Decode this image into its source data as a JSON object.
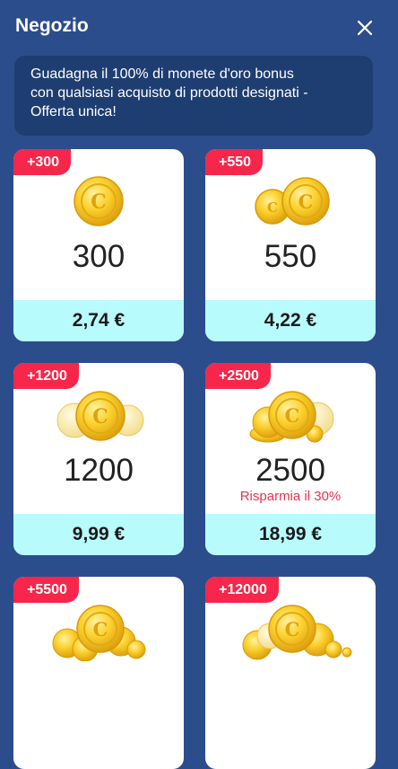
{
  "header": {
    "title": "Negozio"
  },
  "banner": {
    "lines": [
      "Guadagna il 100% di monete d'oro bonus",
      "con qualsiasi acquisto di prodotti designati -",
      "Offerta unica!"
    ]
  },
  "products": [
    {
      "badge": "+300",
      "amount": "300",
      "price": "2,74 €"
    },
    {
      "badge": "+550",
      "amount": "550",
      "price": "4,22 €"
    },
    {
      "badge": "+1200",
      "amount": "1200",
      "price": "9,99 €"
    },
    {
      "badge": "+2500",
      "amount": "2500",
      "price": "18,99 €",
      "saving": "Risparmia il 30%"
    },
    {
      "badge": "+5500"
    },
    {
      "badge": "+12000"
    }
  ],
  "colors": {
    "background": "#2c4d8c",
    "banner": "#1e3d70",
    "badge": "#f7264a",
    "price_bar": "#b8fbfd",
    "saving_text": "#e8344f",
    "coin": "#f5c518"
  },
  "icons": {
    "close": "close-icon",
    "coin": "gold-coin-icon"
  }
}
